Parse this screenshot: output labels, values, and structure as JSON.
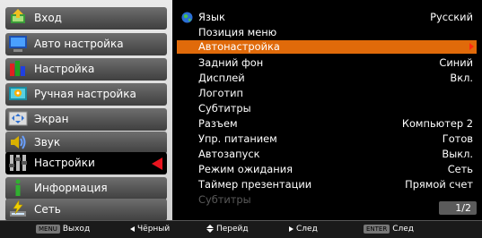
{
  "left_menu": {
    "items": [
      {
        "label": "Вход",
        "icon": "input-icon"
      },
      {
        "label": "Авто настройка",
        "icon": "auto-setup-icon"
      },
      {
        "label": "Настройка",
        "icon": "adjust-icon"
      },
      {
        "label": "Ручная настройка",
        "icon": "manual-setup-icon"
      },
      {
        "label": "Экран",
        "icon": "screen-icon"
      },
      {
        "label": "Звук",
        "icon": "sound-icon"
      },
      {
        "label": "Настройки",
        "icon": "settings-icon"
      },
      {
        "label": "Информация",
        "icon": "info-icon"
      },
      {
        "label": "Сеть",
        "icon": "network-icon"
      }
    ],
    "selected": "Настройки"
  },
  "settings": {
    "rows": [
      {
        "label": "Язык",
        "value": "Русский"
      },
      {
        "label": "Позиция меню",
        "value": ""
      },
      {
        "label": "Автонастройка",
        "value": ""
      },
      {
        "label": "Задний фон",
        "value": "Синий"
      },
      {
        "label": "Дисплей",
        "value": "Вкл."
      },
      {
        "label": "Логотип",
        "value": ""
      },
      {
        "label": "Субтитры",
        "value": ""
      },
      {
        "label": "Разъем",
        "value": "Компьютер 2"
      },
      {
        "label": "Упр. питанием",
        "value": "Готов"
      },
      {
        "label": "Автозапуск",
        "value": "Выкл."
      },
      {
        "label": "Режим ожидания",
        "value": "Сеть"
      },
      {
        "label": "Таймер презентации",
        "value": "Прямой счет"
      },
      {
        "label": "Субтитры",
        "value": ""
      }
    ],
    "highlighted": "Автонастройка",
    "disabled": "Субтитры",
    "page": "1/2"
  },
  "bottom_bar": {
    "menu_key": "MENU",
    "menu_label": "Выход",
    "back_label": "Чёрный",
    "updown_label": "Перейд",
    "next_label": "След",
    "enter_key": "ENTER",
    "enter_label": "След"
  },
  "colors": {
    "highlight": "#e06a0a",
    "arrow": "#e8141e"
  }
}
